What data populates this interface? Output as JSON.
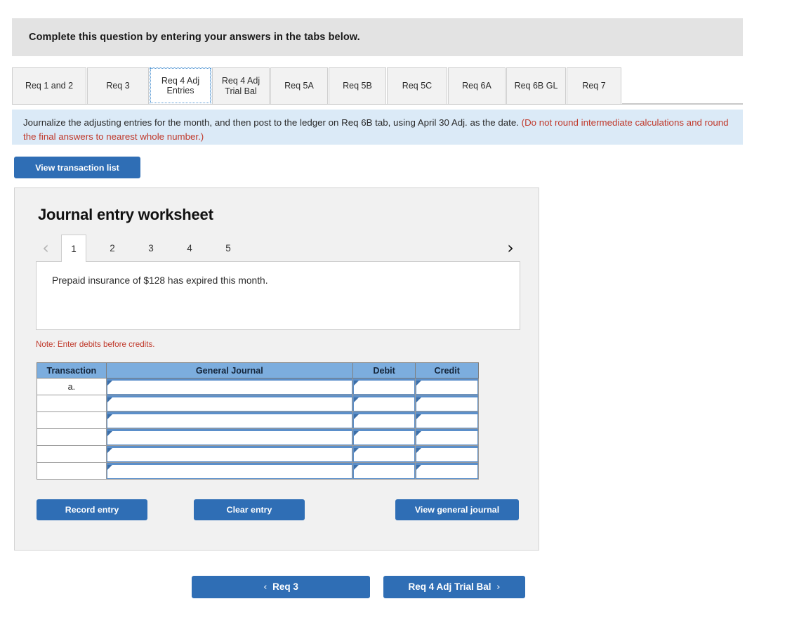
{
  "top_cutoff_text": "",
  "header": {
    "banner_text": "Complete this question by entering your answers in the tabs below."
  },
  "tabs": {
    "items": [
      {
        "label": "Req 1 and 2",
        "active": false
      },
      {
        "label": "Req 3",
        "active": false
      },
      {
        "label": "Req 4 Adj Entries",
        "active": true
      },
      {
        "label": "Req 4 Adj Trial Bal",
        "active": false
      },
      {
        "label": "Req 5A",
        "active": false
      },
      {
        "label": "Req 5B",
        "active": false
      },
      {
        "label": "Req 5C",
        "active": false
      },
      {
        "label": "Req 6A",
        "active": false
      },
      {
        "label": "Req 6B GL",
        "active": false
      },
      {
        "label": "Req 7",
        "active": false
      }
    ],
    "labels_line1": [
      "Req 1 and 2",
      "Req 3",
      "Req 4 Adj",
      "Req 4 Adj",
      "Req 5A",
      "Req 5B",
      "Req 5C",
      "Req 6A",
      "Req 6B GL",
      "Req 7"
    ],
    "labels_line2": [
      "",
      "",
      "Entries",
      "Trial Bal",
      "",
      "",
      "",
      "",
      "",
      ""
    ]
  },
  "instruction": {
    "main": "Journalize the adjusting entries for the month, and then post to the ledger on Req 6B tab, using April 30 Adj. as the date. ",
    "red": "(Do not round intermediate calculations and round the final answers to nearest whole number.)"
  },
  "toolbar": {
    "view_transaction_list_label": "View transaction list"
  },
  "worksheet": {
    "title": "Journal entry worksheet",
    "pager": {
      "prev_icon": "‹",
      "next_icon": "›",
      "pages": [
        "1",
        "2",
        "3",
        "4",
        "5"
      ],
      "active_page": "1"
    },
    "description": "Prepaid insurance of $128 has expired this month.",
    "note": "Note: Enter debits before credits.",
    "table": {
      "headers": [
        "Transaction",
        "General Journal",
        "Debit",
        "Credit"
      ],
      "rows": [
        {
          "transaction": "a.",
          "general_journal": "",
          "debit": "",
          "credit": ""
        },
        {
          "transaction": "",
          "general_journal": "",
          "debit": "",
          "credit": ""
        },
        {
          "transaction": "",
          "general_journal": "",
          "debit": "",
          "credit": ""
        },
        {
          "transaction": "",
          "general_journal": "",
          "debit": "",
          "credit": ""
        },
        {
          "transaction": "",
          "general_journal": "",
          "debit": "",
          "credit": ""
        },
        {
          "transaction": "",
          "general_journal": "",
          "debit": "",
          "credit": ""
        }
      ]
    },
    "actions": {
      "record_label": "Record entry",
      "clear_label": "Clear entry",
      "view_journal_label": "View general journal"
    }
  },
  "bottom_nav": {
    "prev_label": "Req 3",
    "next_label": "Req 4 Adj Trial Bal",
    "prev_icon": "‹",
    "next_icon": "›"
  },
  "colors": {
    "accent_blue": "#2f6eb5",
    "table_header_blue": "#7cadde",
    "instruction_banner_blue": "#dbeaf7",
    "header_band_grey": "#e3e3e3",
    "warning_red": "#c0392b",
    "panel_grey": "#f1f1f1",
    "cell_border_blue": "#5b8fca"
  }
}
